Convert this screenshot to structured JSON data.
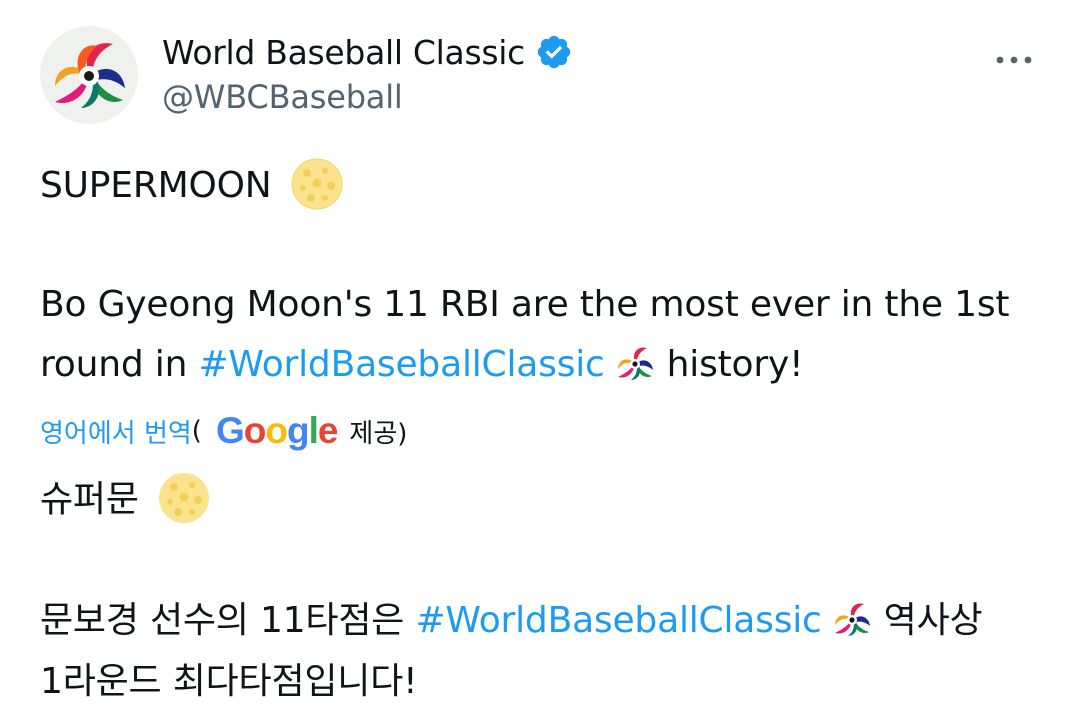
{
  "account": {
    "display_name": "World Baseball Classic",
    "handle": "@WBCBaseball",
    "verified": true
  },
  "icons": {
    "avatar": "wbc-logo-icon",
    "verified": "verified-badge-icon",
    "more": "more-options-icon",
    "moon": "full-moon-emoji",
    "hashtag_emoji": "wbc-logo-hashflag"
  },
  "tweet": {
    "line1": "SUPERMOON",
    "line2": "Bo Gyeong Moon's 11 RBI are the most ever in the 1st",
    "line3_pre": "round in",
    "hashtag": "#WorldBaseballClassic",
    "line3_post": "history!"
  },
  "translation": {
    "link_label": "영어에서 번역",
    "open_paren": "(",
    "google_letters": [
      "G",
      "o",
      "o",
      "g",
      "l",
      "e"
    ],
    "provided": "제공)",
    "line1": "슈퍼문",
    "line2_pre": "문보경 선수의 11타점은",
    "hashtag": "#WorldBaseballClassic",
    "line2_post": "역사상",
    "line3": "1라운드 최다타점입니다!"
  },
  "colors": {
    "text": "#0f1419",
    "secondary": "#536471",
    "link": "#1d9bf0",
    "verified": "#1d9bf0",
    "background": "#ffffff",
    "avatar_bg": "#eff1ef",
    "google_blue": "#4285f4",
    "google_red": "#ea4335",
    "google_yellow": "#fbbc05",
    "google_green": "#34a853"
  }
}
